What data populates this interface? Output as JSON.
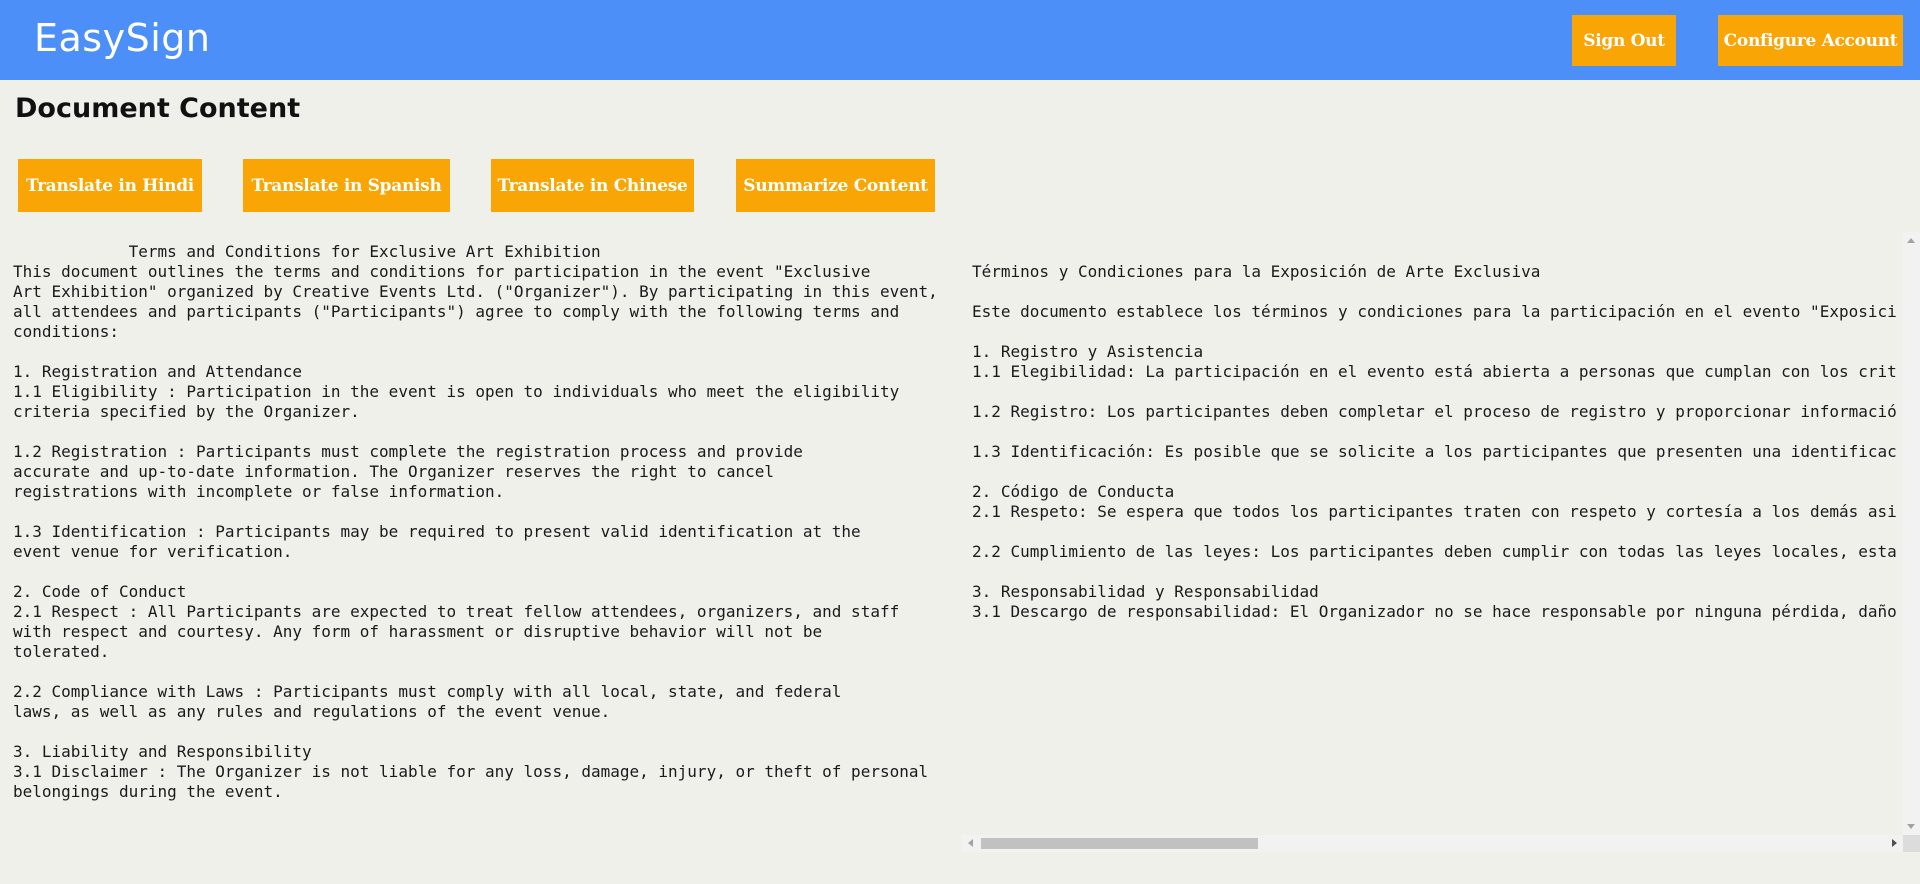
{
  "header": {
    "brand": "EasySign",
    "sign_out_label": "Sign Out",
    "configure_account_label": "Configure Account"
  },
  "page": {
    "title": "Document Content"
  },
  "actions": {
    "translate_hindi": "Translate in Hindi",
    "translate_spanish": "Translate in Spanish",
    "translate_chinese": "Translate in Chinese",
    "summarize": "Summarize Content"
  },
  "document": {
    "original_text": "            Terms and Conditions for Exclusive Art Exhibition\nThis document outlines the terms and conditions for participation in the event \"Exclusive\nArt Exhibition\" organized by Creative Events Ltd. (\"Organizer\"). By participating in this event,\nall attendees and participants (\"Participants\") agree to comply with the following terms and\nconditions:\n\n1. Registration and Attendance\n1.1 Eligibility : Participation in the event is open to individuals who meet the eligibility\ncriteria specified by the Organizer.\n\n1.2 Registration : Participants must complete the registration process and provide\naccurate and up-to-date information. The Organizer reserves the right to cancel\nregistrations with incomplete or false information.\n\n1.3 Identification : Participants may be required to present valid identification at the\nevent venue for verification.\n\n2. Code of Conduct\n2.1 Respect : All Participants are expected to treat fellow attendees, organizers, and staff\nwith respect and courtesy. Any form of harassment or disruptive behavior will not be\ntolerated.\n\n2.2 Compliance with Laws : Participants must comply with all local, state, and federal\nlaws, as well as any rules and regulations of the event venue.\n\n3. Liability and Responsibility\n3.1 Disclaimer : The Organizer is not liable for any loss, damage, injury, or theft of personal\nbelongings during the event.",
    "translated_text": "\nTérminos y Condiciones para la Exposición de Arte Exclusiva\n\nEste documento establece los términos y condiciones para la participación en el evento \"Exposici\n\n1. Registro y Asistencia\n1.1 Elegibilidad: La participación en el evento está abierta a personas que cumplan con los crit\n\n1.2 Registro: Los participantes deben completar el proceso de registro y proporcionar informació\n\n1.3 Identificación: Es posible que se solicite a los participantes que presenten una identificac\n\n2. Código de Conducta\n2.1 Respeto: Se espera que todos los participantes traten con respeto y cortesía a los demás asi\n\n2.2 Cumplimiento de las leyes: Los participantes deben cumplir con todas las leyes locales, esta\n\n3. Responsabilidad y Responsabilidad\n3.1 Descargo de responsabilidad: El Organizador no se hace responsable por ninguna pérdida, daño"
  },
  "colors": {
    "header_bg": "#4d8ff9",
    "button_bg": "#f8a505",
    "page_bg": "#f0f0eb"
  }
}
